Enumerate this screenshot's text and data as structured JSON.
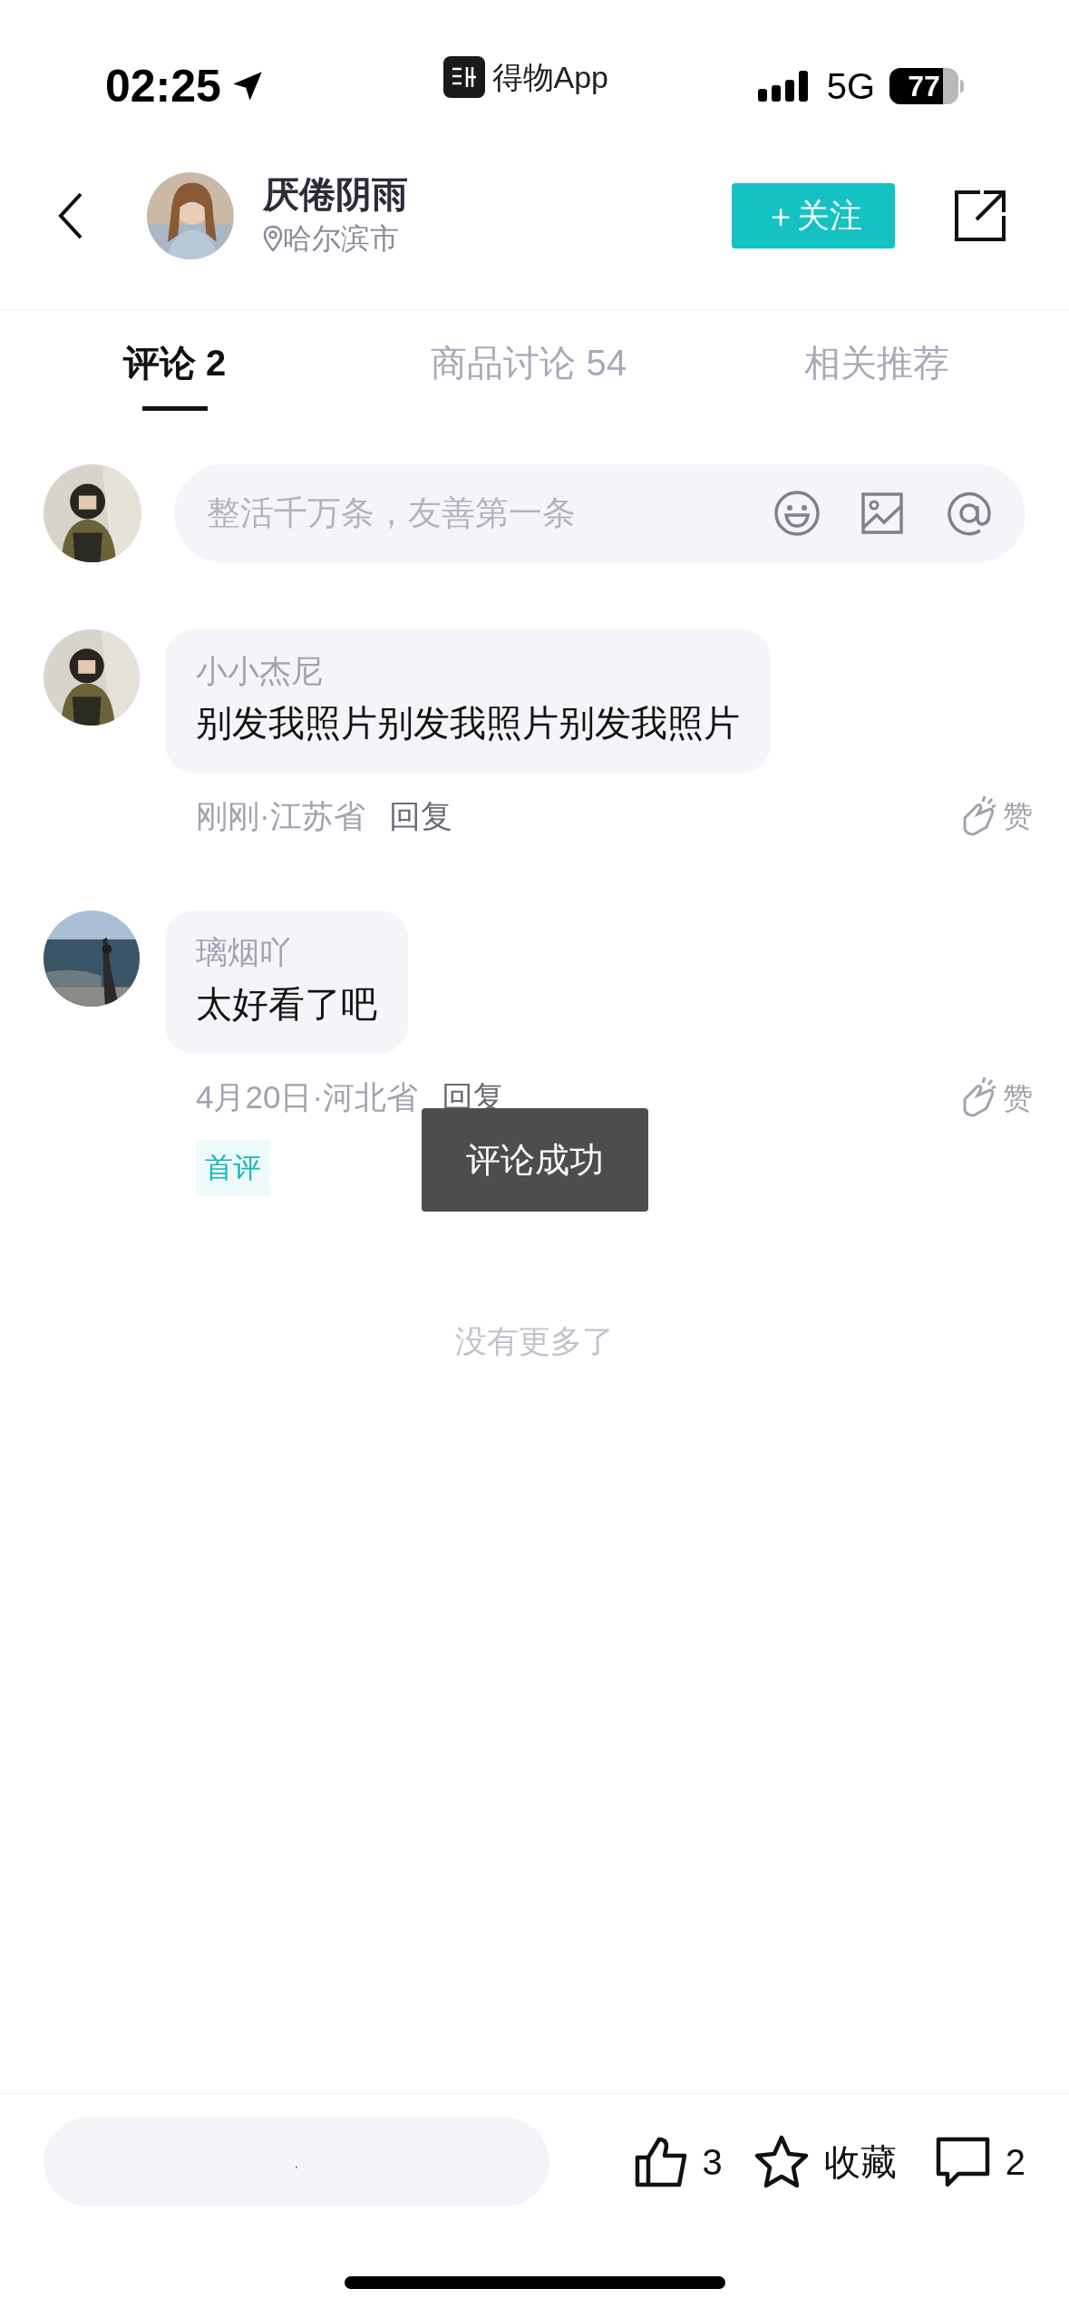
{
  "status_bar": {
    "time": "02:25",
    "app": "得物App",
    "network": "5G",
    "battery": "77"
  },
  "header": {
    "name": "厌倦阴雨",
    "location": "哈尔滨市",
    "follow_button": "＋关注"
  },
  "tabs": [
    {
      "label": "评论 2",
      "selected": true
    },
    {
      "label": "商品讨论 54",
      "selected": false
    },
    {
      "label": "相关推荐",
      "selected": false
    }
  ],
  "composer": {
    "placeholder": "整活千万条，友善第一条"
  },
  "comments": [
    {
      "user": "小小杰尼",
      "text": "别发我照片别发我照片别发我照片",
      "meta": "刚刚·江苏省",
      "reply": "回复",
      "like": "赞"
    },
    {
      "user": "璃烟吖",
      "text": "太好看了吧",
      "meta": "4月20日·河北省",
      "reply": "回复",
      "like": "赞",
      "badge": "首评"
    }
  ],
  "toast": "评论成功",
  "end_note": "没有更多了",
  "bottom_bar": {
    "input_value": ".",
    "likes": "3",
    "favorite": "收藏",
    "comments": "2"
  }
}
